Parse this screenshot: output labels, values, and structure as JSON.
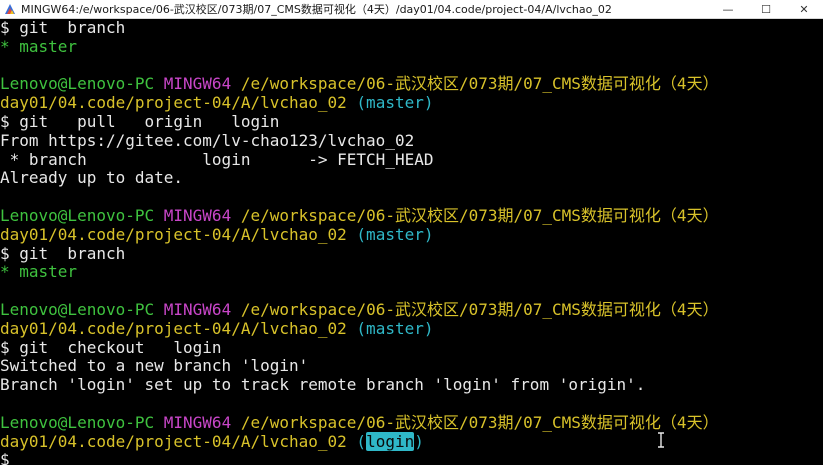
{
  "window": {
    "title": "MINGW64:/e/workspace/06-武汉校区/073期/07_CMS数据可视化（4天）/day01/04.code/project-04/A/lvchao_02",
    "minimize_glyph": "—",
    "maximize_glyph": "☐",
    "close_glyph": "✕"
  },
  "terminal": {
    "lines": [
      {
        "s1": "$ git  branch"
      },
      {
        "s1": "* master"
      },
      {
        "s1": ""
      },
      {
        "user": "Lenovo@Lenovo-PC",
        "env": "MINGW64",
        "path": "/e/workspace/06-武汉校区/073期/07_CMS数据可视化（4天）"
      },
      {
        "path2": "day01/04.code/project-04/A/lvchao_02",
        "branch": "(master)"
      },
      {
        "s1": "$ git   pull   origin   login"
      },
      {
        "s1": "From https://gitee.com/lv-chao123/lvchao_02"
      },
      {
        "s1": " * branch            login      -> FETCH_HEAD"
      },
      {
        "s1": "Already up to date."
      },
      {
        "s1": ""
      },
      {
        "user": "Lenovo@Lenovo-PC",
        "env": "MINGW64",
        "path": "/e/workspace/06-武汉校区/073期/07_CMS数据可视化（4天）"
      },
      {
        "path2": "day01/04.code/project-04/A/lvchao_02",
        "branch": "(master)"
      },
      {
        "s1": "$ git  branch"
      },
      {
        "s1": "* master"
      },
      {
        "s1": ""
      },
      {
        "user": "Lenovo@Lenovo-PC",
        "env": "MINGW64",
        "path": "/e/workspace/06-武汉校区/073期/07_CMS数据可视化（4天）"
      },
      {
        "path2": "day01/04.code/project-04/A/lvchao_02",
        "branch": "(master)"
      },
      {
        "s1": "$ git  checkout   login"
      },
      {
        "s1": "Switched to a new branch 'login'"
      },
      {
        "s1": "Branch 'login' set up to track remote branch 'login' from 'origin'."
      },
      {
        "s1": ""
      },
      {
        "user": "Lenovo@Lenovo-PC",
        "env": "MINGW64",
        "path": "/e/workspace/06-武汉校区/073期/07_CMS数据可视化（4天）"
      },
      {
        "path2": "day01/04.code/project-04/A/lvchao_02",
        "branch_open": "(",
        "branch_sel": "login",
        "branch_close": ")"
      },
      {
        "s1": "$"
      }
    ]
  },
  "colors": {
    "user": "#3fc23f",
    "env": "#c846c8",
    "path": "#d8c22a",
    "branch": "#2fb8c8",
    "text": "#e8e8e8",
    "background": "#000000"
  }
}
